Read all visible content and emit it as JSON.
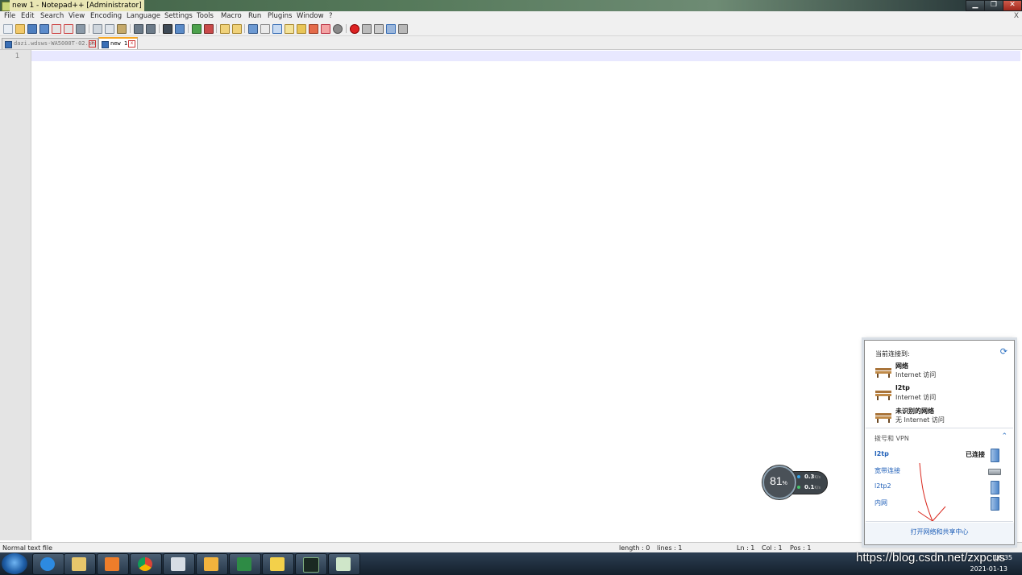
{
  "window": {
    "title": "new 1 - Notepad++ [Administrator]",
    "controls": {
      "minimize": "▁",
      "maximize": "❐",
      "close": "✕"
    }
  },
  "menu": {
    "items": [
      "File",
      "Edit",
      "Search",
      "View",
      "Encoding",
      "Language",
      "Settings",
      "Tools",
      "Macro",
      "Run",
      "Plugins",
      "Window",
      "?"
    ],
    "close_label": "X"
  },
  "tabs": [
    {
      "label": "dazi.wdsws-WA5000T-02.sh"
    },
    {
      "label": "new 1",
      "active": true
    }
  ],
  "editor": {
    "line_numbers": [
      "1"
    ]
  },
  "statusbar": {
    "file_type": "Normal text file",
    "length": "length : 0",
    "lines": "lines : 1",
    "ln": "Ln : 1",
    "col": "Col : 1",
    "pos": "Pos : 1"
  },
  "network_flyout": {
    "header": "当前连接到:",
    "networks": [
      {
        "name": "网络",
        "status": "Internet 访问"
      },
      {
        "name": "l2tp",
        "status": "Internet 访问"
      },
      {
        "name": "未识别的网络",
        "status": "无 Internet 访问"
      }
    ],
    "dial_header": "拨号和 VPN",
    "vpn_items": [
      {
        "name": "l2tp",
        "status": "已连接",
        "icon": "vpn-icon"
      },
      {
        "name": "宽带连接",
        "status": "",
        "icon": "modem-icon"
      },
      {
        "name": "l2tp2",
        "status": "",
        "icon": "vpn-icon"
      },
      {
        "name": "内网",
        "status": "",
        "icon": "vpn-icon"
      }
    ],
    "footer_link": "打开网络和共享中心"
  },
  "speed_widget": {
    "percent": "81",
    "percent_unit": "%",
    "upload": "0.3",
    "download": "0.1",
    "unit": "K/s"
  },
  "taskbar": {
    "apps": [
      "internet-explorer",
      "file-explorer",
      "media-player",
      "chrome",
      "remote-desktop",
      "virtualbox",
      "excel",
      "help",
      "terminal",
      "task-manager"
    ],
    "time": "16:35",
    "date": "2021-01-13"
  },
  "watermark": "https://blog.csdn.net/zxpcus",
  "colors": {
    "title_gradient_start": "#3f5f45",
    "current_line": "#e8e8ff",
    "link_blue": "#1f5fb8",
    "taskbar": "#1d2c3b"
  }
}
